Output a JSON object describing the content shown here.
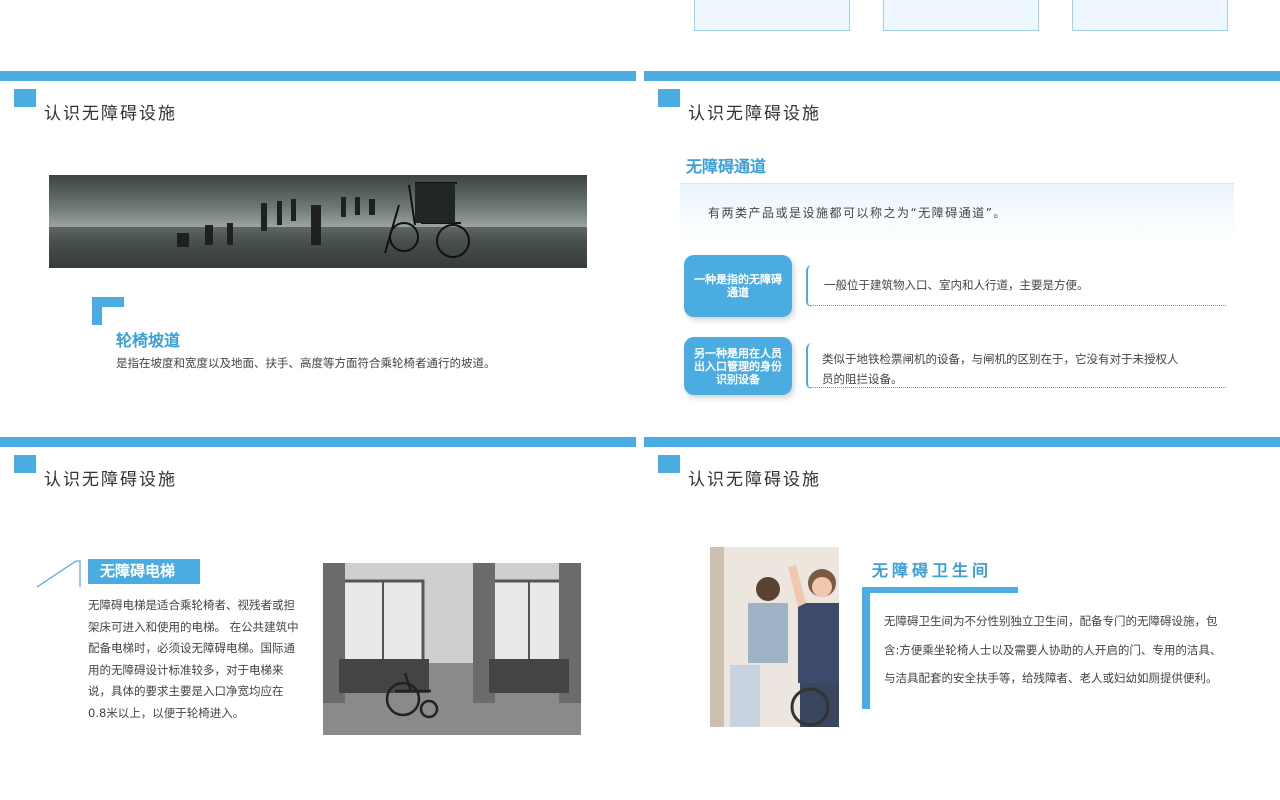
{
  "slides": {
    "s1": {
      "title": "认识无障碍设施",
      "heading": "轮椅坡道",
      "desc": "是指在坡度和宽度以及地面、扶手、高度等方面符合乘轮椅者通行的坡道。"
    },
    "s2": {
      "title": "认识无障碍设施",
      "heading": "无障碍通道",
      "banner": "有两类产品或是设施都可以称之为“无障碍通道”。",
      "items": [
        {
          "pill": "一种是指的无障碍通道",
          "text": "一般位于建筑物入口、室内和人行道，主要是方便。"
        },
        {
          "pill": "另一种是用在人员出入口管理的身份识别设备",
          "text": "类似于地铁检票闸机的设备，与闸机的区别在于，它没有对于未授权人员的阻拦设备。"
        }
      ]
    },
    "s3": {
      "title": "认识无障碍设施",
      "heading": "无障碍电梯",
      "desc": "无障碍电梯是适合乘轮椅者、视残者或担架床可进入和使用的电梯。 在公共建筑中配备电梯时，必须设无障碍电梯。国际通用的无障碍设计标准较多，对于电梯来说，具体的要求主要是入口净宽均应在0.8米以上，以便于轮椅进入。"
    },
    "s4": {
      "title": "认识无障碍设施",
      "heading": "无障碍卫生间",
      "desc": "无障碍卫生间为不分性别独立卫生间，配备专门的无障碍设施，包含:方便乘坐轮椅人士以及需要人协助的人开启的门、专用的洁具、与洁具配套的安全扶手等，给残障者、老人或妇幼如厕提供便利。"
    }
  },
  "colors": {
    "accent": "#4aace0",
    "heading": "#3d9fd8"
  },
  "icons": [
    "wheelchair-seaside-photo",
    "wheelchair-room-photo",
    "women-cheering-photo"
  ]
}
